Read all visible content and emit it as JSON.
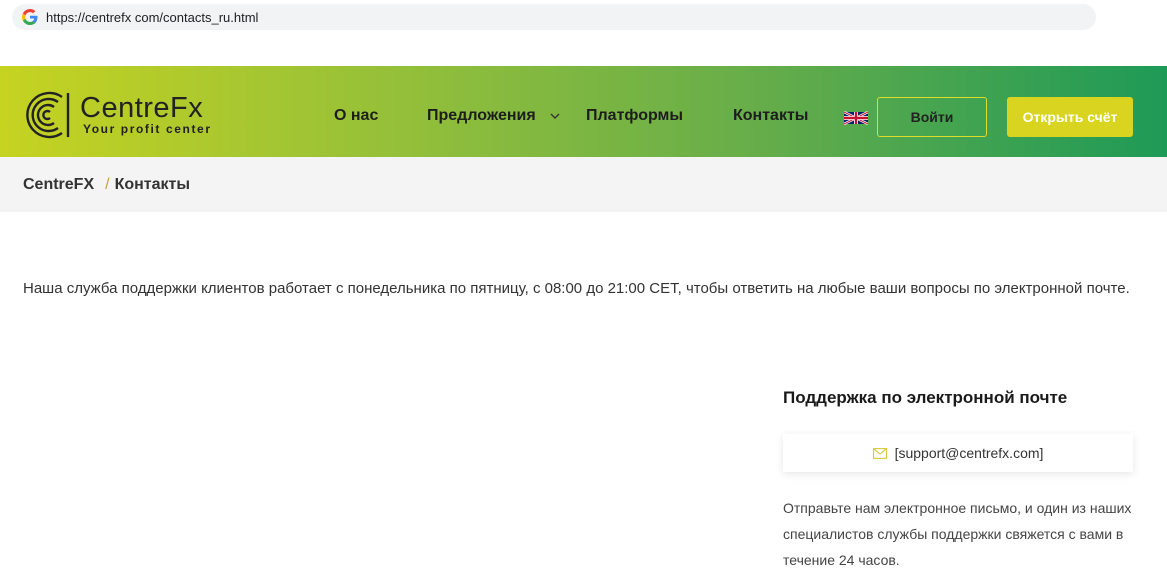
{
  "browser": {
    "url": "https://centrefx com/contacts_ru.html"
  },
  "header": {
    "logo_name": "CentreFx",
    "logo_tagline": "Your profit center",
    "nav": {
      "about": "О нас",
      "offers": "Предложения",
      "platforms": "Платформы",
      "contacts": "Контакты"
    },
    "language_icon": "uk-flag-icon",
    "login_label": "Войти",
    "open_account_label": "Открыть счёт"
  },
  "breadcrumb": {
    "home": "CentreFX",
    "separator": "/",
    "current": "Контакты"
  },
  "main": {
    "intro": "Наша служба поддержки клиентов работает с понедельника по пятницу, с 08:00 до 21:00 CET, чтобы ответить на любые ваши вопросы по электронной почте.",
    "support_title": "Поддержка по электронной почте",
    "support_email": "[support@centrefx.com]",
    "support_description": "Отправьте нам электронное письмо, и один из наших специалистов службы поддержки свяжется с вами в течение 24 часов."
  },
  "colors": {
    "gradient_start": "#c6d321",
    "gradient_end": "#1e9a57",
    "accent_yellow": "#d9d41f",
    "breadcrumb_bg": "#f4f4f4"
  }
}
